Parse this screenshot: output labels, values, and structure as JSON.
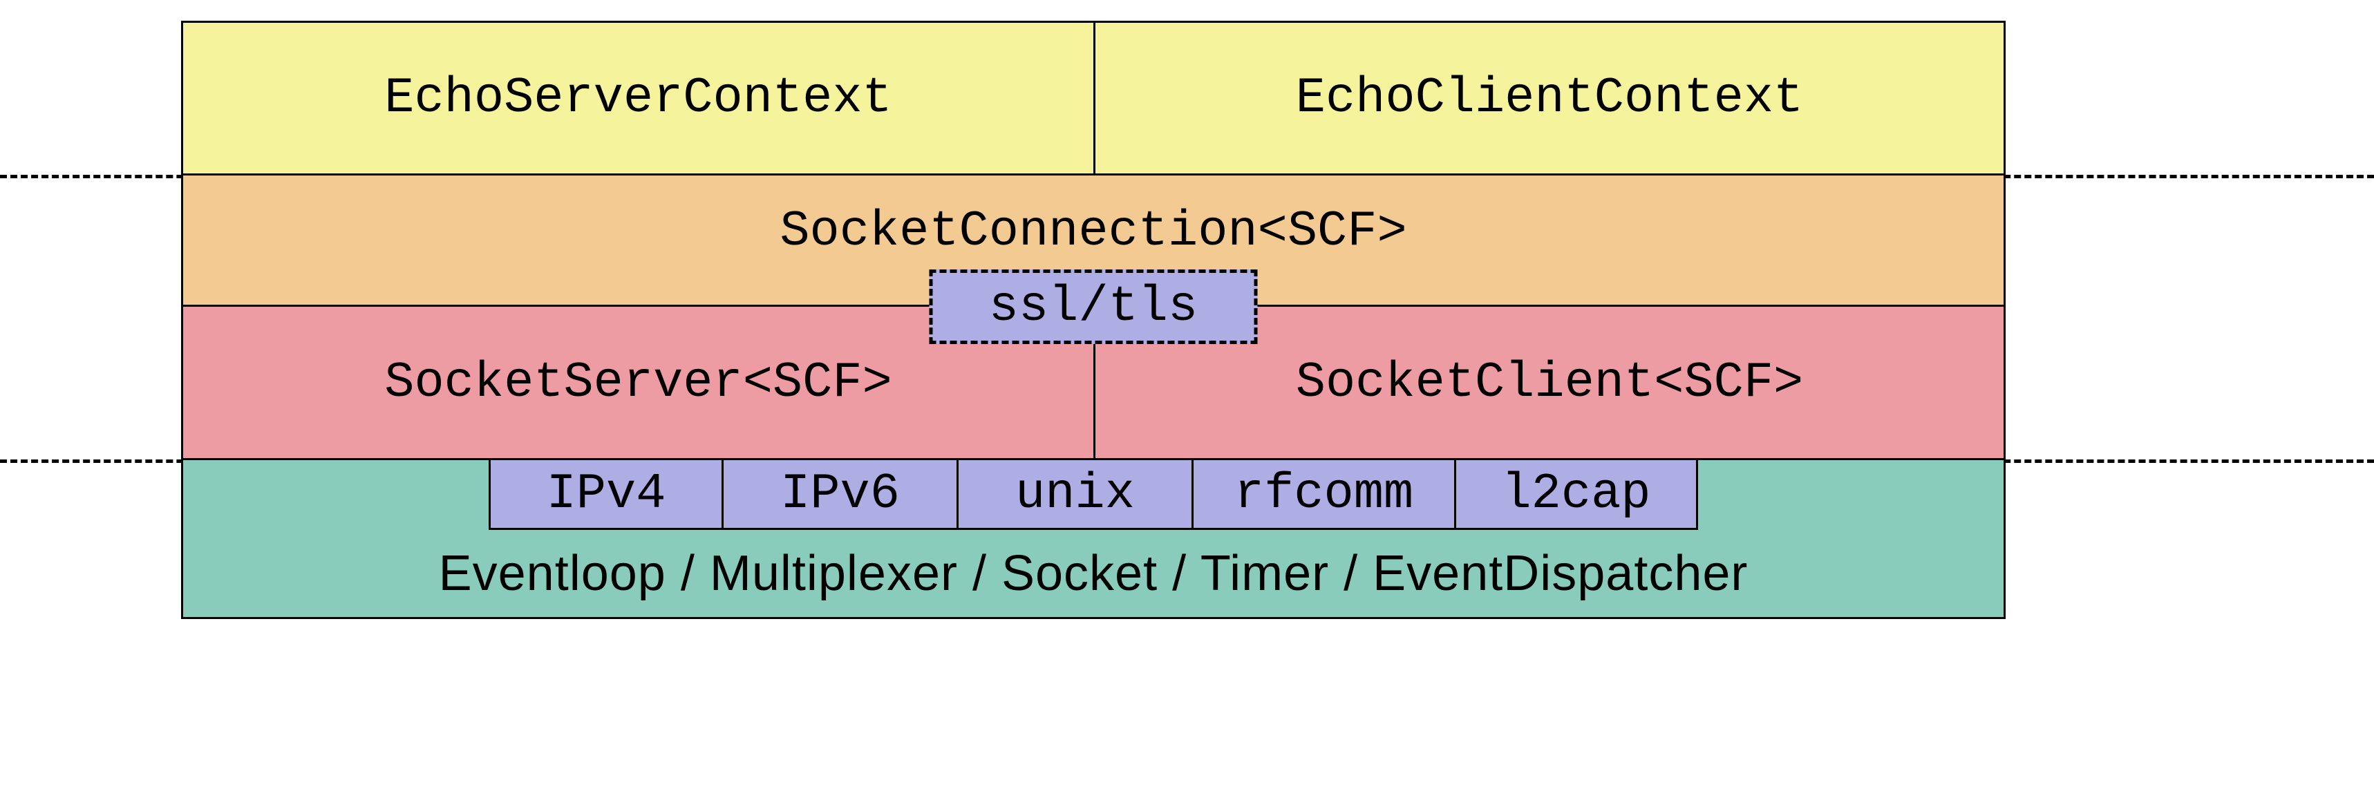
{
  "layers": {
    "contexts": {
      "server": "EchoServerContext",
      "client": "EchoClientContext"
    },
    "connection": "SocketConnection<SCF>",
    "ssl": "ssl/tls",
    "socket": {
      "server": "SocketServer<SCF>",
      "client": "SocketClient<SCF>"
    },
    "protocols": [
      "IPv4",
      "IPv6",
      "unix",
      "rfcomm",
      "l2cap"
    ],
    "base": "Eventloop / Multiplexer / Socket / Timer / EventDispatcher"
  },
  "colors": {
    "yellow": "#f5f49d",
    "orange": "#f3cb92",
    "red": "#ee9ca4",
    "teal": "#89ccbb",
    "violet": "#aeaee4"
  }
}
